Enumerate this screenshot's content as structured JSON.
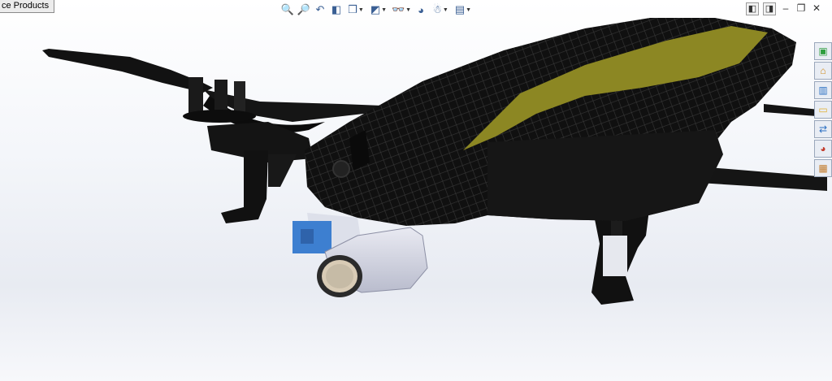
{
  "tab": {
    "label": "ce Products"
  },
  "hud_toolbar": [
    {
      "icon": "zoom-to-fit-icon",
      "glyph": "🔍",
      "dropdown": false
    },
    {
      "icon": "zoom-to-area-icon",
      "glyph": "🔎",
      "dropdown": false
    },
    {
      "icon": "previous-view-icon",
      "glyph": "↶",
      "dropdown": false
    },
    {
      "icon": "section-view-icon",
      "glyph": "◧",
      "dropdown": false
    },
    {
      "icon": "view-orientation-icon",
      "glyph": "❒",
      "dropdown": true
    },
    {
      "icon": "display-style-icon",
      "glyph": "◩",
      "dropdown": true
    },
    {
      "icon": "hide-show-items-icon",
      "glyph": "👓",
      "dropdown": true
    },
    {
      "icon": "edit-appearance-icon",
      "glyph": "◕",
      "dropdown": false
    },
    {
      "icon": "apply-scene-icon",
      "glyph": "☃",
      "dropdown": true
    },
    {
      "icon": "view-settings-icon",
      "glyph": "▤",
      "dropdown": true
    }
  ],
  "window_controls": [
    {
      "icon": "tile-left-icon",
      "glyph": "◧"
    },
    {
      "icon": "tile-right-icon",
      "glyph": "◨"
    },
    {
      "icon": "minimize-icon",
      "glyph": "–"
    },
    {
      "icon": "restore-icon",
      "glyph": "❐"
    },
    {
      "icon": "close-icon",
      "glyph": "✕"
    }
  ],
  "task_pane": [
    {
      "icon": "solidworks-resources-icon",
      "glyph": "▣",
      "color": "#2e9e3e"
    },
    {
      "icon": "home-icon",
      "glyph": "⌂",
      "color": "#d08a1a"
    },
    {
      "icon": "design-library-icon",
      "glyph": "▥",
      "color": "#2a6fc2"
    },
    {
      "icon": "file-explorer-icon",
      "glyph": "▭",
      "color": "#e0b030"
    },
    {
      "icon": "view-palette-icon",
      "glyph": "⇄",
      "color": "#2a6fc2"
    },
    {
      "icon": "appearances-icon",
      "glyph": "◕",
      "color": "#c23a2a"
    },
    {
      "icon": "custom-properties-icon",
      "glyph": "▦",
      "color": "#c27a2a"
    }
  ],
  "model": {
    "body_color": "#111111",
    "stripe_color": "#8c8723",
    "camera_blue": "#3d7fd0",
    "camera_housing": "#d7d9e6"
  }
}
